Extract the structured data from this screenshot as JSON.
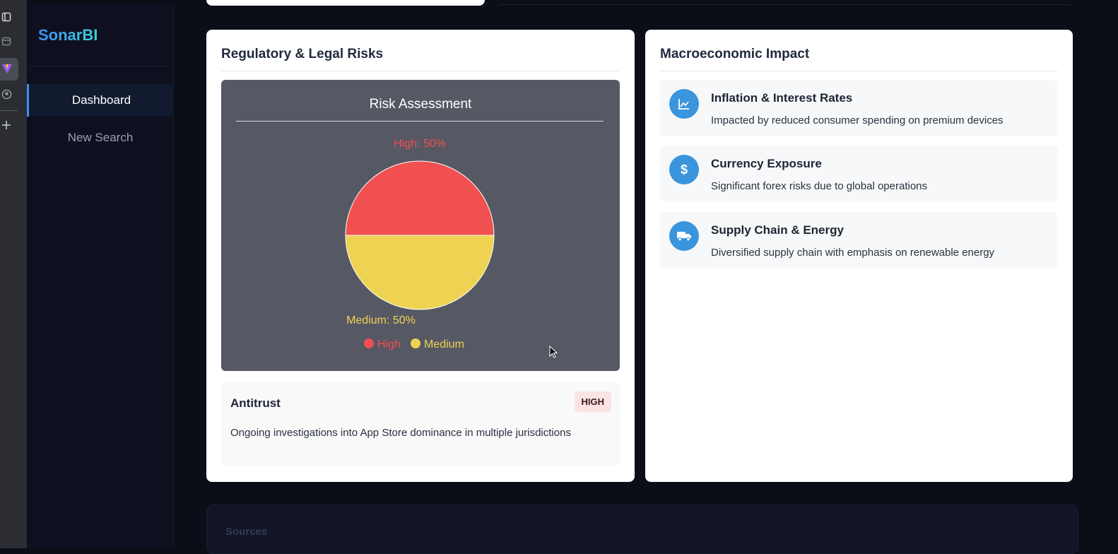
{
  "app": {
    "name": "SonarBI"
  },
  "sidebar": {
    "items": [
      {
        "label": "Dashboard",
        "active": true
      },
      {
        "label": "New Search",
        "active": false
      }
    ]
  },
  "regulatory": {
    "title": "Regulatory & Legal Risks",
    "chart_data": {
      "type": "pie",
      "title": "Risk Assessment",
      "categories": [
        "High",
        "Medium"
      ],
      "values": [
        50,
        50
      ],
      "colors": [
        "#f05050",
        "#eed352"
      ],
      "slice_labels": [
        "High: 50%",
        "Medium: 50%"
      ],
      "legend": [
        "High",
        "Medium"
      ],
      "legend_position": "bottom"
    },
    "risks": [
      {
        "name": "Antitrust",
        "level": "HIGH",
        "description": "Ongoing investigations into App Store dominance in multiple jurisdictions"
      }
    ]
  },
  "macro": {
    "title": "Macroeconomic Impact",
    "items": [
      {
        "icon": "chart-line-icon",
        "title": "Inflation & Interest Rates",
        "description": "Impacted by reduced consumer spending on premium devices"
      },
      {
        "icon": "dollar-icon",
        "title": "Currency Exposure",
        "description": "Significant forex risks due to global operations"
      },
      {
        "icon": "truck-icon",
        "title": "Supply Chain & Energy",
        "description": "Diversified supply chain with emphasis on renewable energy"
      }
    ]
  },
  "sources": {
    "title": "Sources"
  },
  "colors": {
    "accent": "#3a95dd",
    "high": "#f05050",
    "medium": "#eed352",
    "panel": "#565864"
  }
}
